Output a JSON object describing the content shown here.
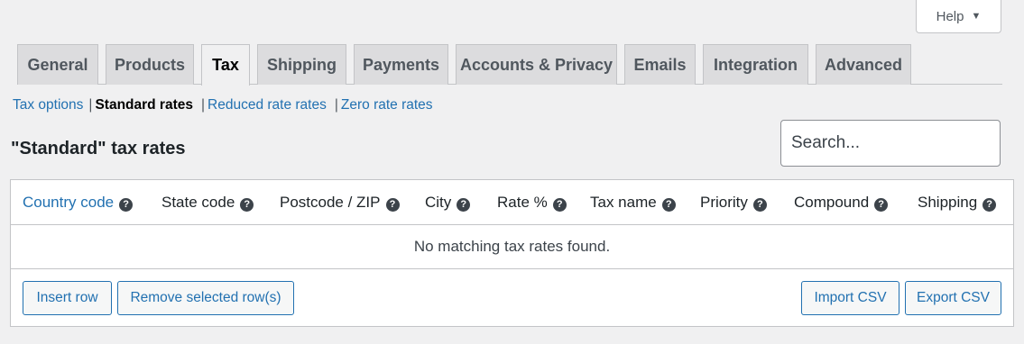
{
  "help": {
    "label": "Help",
    "caret": "▼"
  },
  "tabs": [
    {
      "label": "General"
    },
    {
      "label": "Products"
    },
    {
      "label": "Tax",
      "active": true
    },
    {
      "label": "Shipping"
    },
    {
      "label": "Payments"
    },
    {
      "label": "Accounts & Privacy"
    },
    {
      "label": "Emails"
    },
    {
      "label": "Integration"
    },
    {
      "label": "Advanced"
    }
  ],
  "sections": {
    "tax_options": "Tax options",
    "sep": "|",
    "standard_rates": "Standard rates",
    "reduced_rates": "Reduced rate rates",
    "zero_rates": "Zero rate rates"
  },
  "heading": "\"Standard\" tax rates",
  "search": {
    "placeholder": "Search..."
  },
  "table": {
    "columns": {
      "country": "Country code",
      "state": "State code",
      "postcode": "Postcode / ZIP",
      "city": "City",
      "rate": "Rate %",
      "tax_name": "Tax name",
      "priority": "Priority",
      "compound": "Compound",
      "shipping": "Shipping"
    },
    "help_glyph": "?",
    "empty_message": "No matching tax rates found."
  },
  "buttons": {
    "insert_row": "Insert row",
    "remove_rows": "Remove selected row(s)",
    "import_csv": "Import CSV",
    "export_csv": "Export CSV"
  },
  "colors": {
    "link": "#2271b1",
    "tab_bg": "#dcdcde",
    "page_bg": "#f0f0f1"
  }
}
